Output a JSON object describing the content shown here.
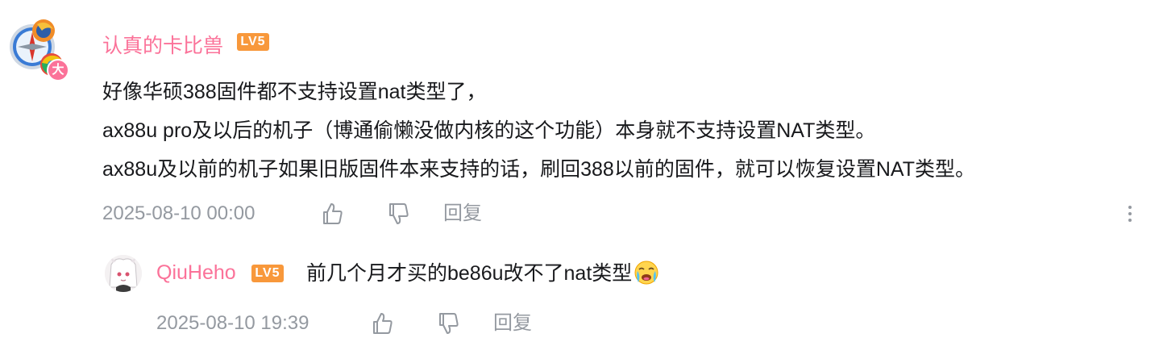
{
  "comment": {
    "username": "认真的卡比兽",
    "level": "LV5",
    "avatar_badge": "大",
    "lines": [
      "好像华硕388固件都不支持设置nat类型了，",
      "ax88u pro及以后的机子（博通偷懒没做内核的这个功能）本身就不支持设置NAT类型。",
      "ax88u及以前的机子如果旧版固件本来支持的话，刷回388以前的固件，就可以恢复设置NAT类型。"
    ],
    "time": "2025-08-10 00:00",
    "like_icon": "thumbs-up-icon",
    "dislike_icon": "thumbs-down-icon",
    "reply_label": "回复",
    "more_icon": "more-vertical-icon"
  },
  "reply": {
    "username": "QiuHeho",
    "level": "LV5",
    "text": "前几个月才买的be86u改不了nat类型",
    "emoji": "crying-face-emoji",
    "time": "2025-08-10 19:39",
    "like_icon": "thumbs-up-icon",
    "dislike_icon": "thumbs-down-icon",
    "reply_label": "回复"
  },
  "colors": {
    "username": "#fb7299",
    "level_badge": "#f8983b",
    "meta_text": "#9499a0",
    "body_text": "#18191c"
  }
}
